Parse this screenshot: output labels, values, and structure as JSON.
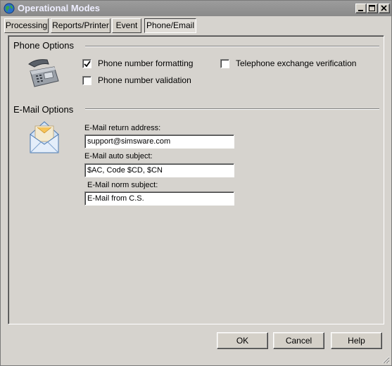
{
  "window": {
    "title": "Operational Modes",
    "controls": {
      "minimize": "minimize-icon",
      "maximize": "maximize-icon",
      "close": "close-icon"
    }
  },
  "tabs": [
    {
      "label": "Processing",
      "active": false
    },
    {
      "label": "Reports/Printer",
      "active": false
    },
    {
      "label": "Event",
      "active": false
    },
    {
      "label": "Phone/Email",
      "active": true
    }
  ],
  "phone": {
    "title": "Phone Options",
    "icon": "telephone-icon",
    "formatting": {
      "label": "Phone number formatting",
      "checked": true
    },
    "validation": {
      "label": "Phone number validation",
      "checked": false
    },
    "exchange": {
      "label": "Telephone exchange verification",
      "checked": false
    }
  },
  "email": {
    "title": "E-Mail Options",
    "icon": "envelope-icon",
    "return_address": {
      "label": "E-Mail return address:",
      "value": "support@simsware.com"
    },
    "auto_subject": {
      "label": "E-Mail auto subject:",
      "value": "$AC, Code $CD, $CN"
    },
    "norm_subject": {
      "label": "E-Mail norm subject:",
      "value": "E-Mail from C.S."
    }
  },
  "buttons": {
    "ok": "OK",
    "cancel": "Cancel",
    "help": "Help"
  },
  "colors": {
    "window_bg": "#d6d3ce",
    "titlebar": "#8e8e8e"
  }
}
